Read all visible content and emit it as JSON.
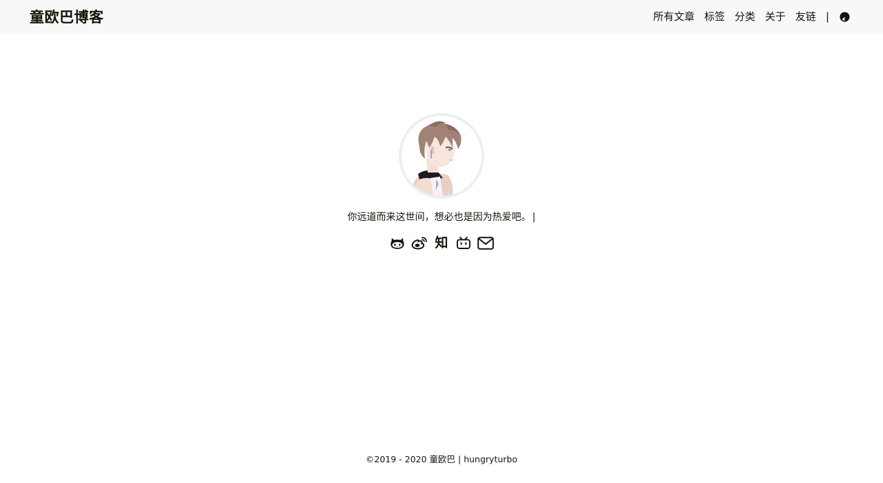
{
  "header": {
    "brand": "童欧巴博客",
    "nav": [
      {
        "label": "所有文章"
      },
      {
        "label": "标签"
      },
      {
        "label": "分类"
      },
      {
        "label": "关于"
      },
      {
        "label": "友链"
      }
    ],
    "separator": "|",
    "theme_toggle_icon": "half-circle-theme-icon"
  },
  "main": {
    "avatar_alt": "anime boy avatar",
    "subtitle": "你远道而来这世间，想必也是因为热爱吧。",
    "typing_cursor": "|",
    "social": [
      {
        "name": "github",
        "icon": "github-icon"
      },
      {
        "name": "weibo",
        "icon": "weibo-icon"
      },
      {
        "name": "zhihu",
        "icon": "zhihu-icon",
        "glyph": "知"
      },
      {
        "name": "bilibili",
        "icon": "bilibili-icon"
      },
      {
        "name": "email",
        "icon": "mail-icon"
      }
    ]
  },
  "footer": {
    "copyright_symbol": "©",
    "text": "2019 - 2020 童欧巴 | hungryturbo"
  },
  "colors": {
    "text": "#161209",
    "header_bg": "#f8f8f8",
    "avatar_border": "#eeeeee",
    "page_bg": "#ffffff"
  }
}
